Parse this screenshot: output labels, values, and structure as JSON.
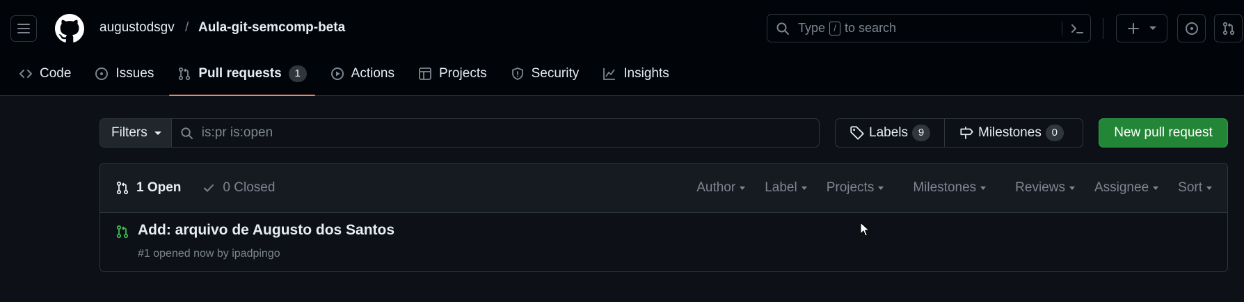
{
  "header": {
    "owner": "augustodsgv",
    "separator": "/",
    "repo": "Aula-git-semcomp-beta",
    "search": {
      "prefix": "Type",
      "key": "/",
      "suffix": "to search"
    }
  },
  "tabs": [
    {
      "label": "Code",
      "icon": "code-icon"
    },
    {
      "label": "Issues",
      "icon": "issue-opened-icon"
    },
    {
      "label": "Pull requests",
      "icon": "git-pull-request-icon",
      "counter": "1",
      "active": true
    },
    {
      "label": "Actions",
      "icon": "play-icon"
    },
    {
      "label": "Projects",
      "icon": "table-icon"
    },
    {
      "label": "Security",
      "icon": "shield-icon"
    },
    {
      "label": "Insights",
      "icon": "graph-icon"
    }
  ],
  "subnav": {
    "filters_label": "Filters",
    "query": "is:pr is:open",
    "labels_label": "Labels",
    "labels_count": "9",
    "milestones_label": "Milestones",
    "milestones_count": "0",
    "new_pr_label": "New pull request"
  },
  "list": {
    "open_label": "1 Open",
    "closed_label": "0 Closed",
    "sorters": [
      "Author",
      "Label",
      "Projects",
      "Milestones",
      "Reviews",
      "Assignee",
      "Sort"
    ],
    "items": [
      {
        "title": "Add: arquivo de Augusto dos Santos",
        "meta": "#1 opened now by ipadpingo"
      }
    ]
  },
  "colors": {
    "accent": "#f78166",
    "primary_button": "#238636",
    "open_icon": "#3fb950",
    "background": "#0d1117"
  }
}
